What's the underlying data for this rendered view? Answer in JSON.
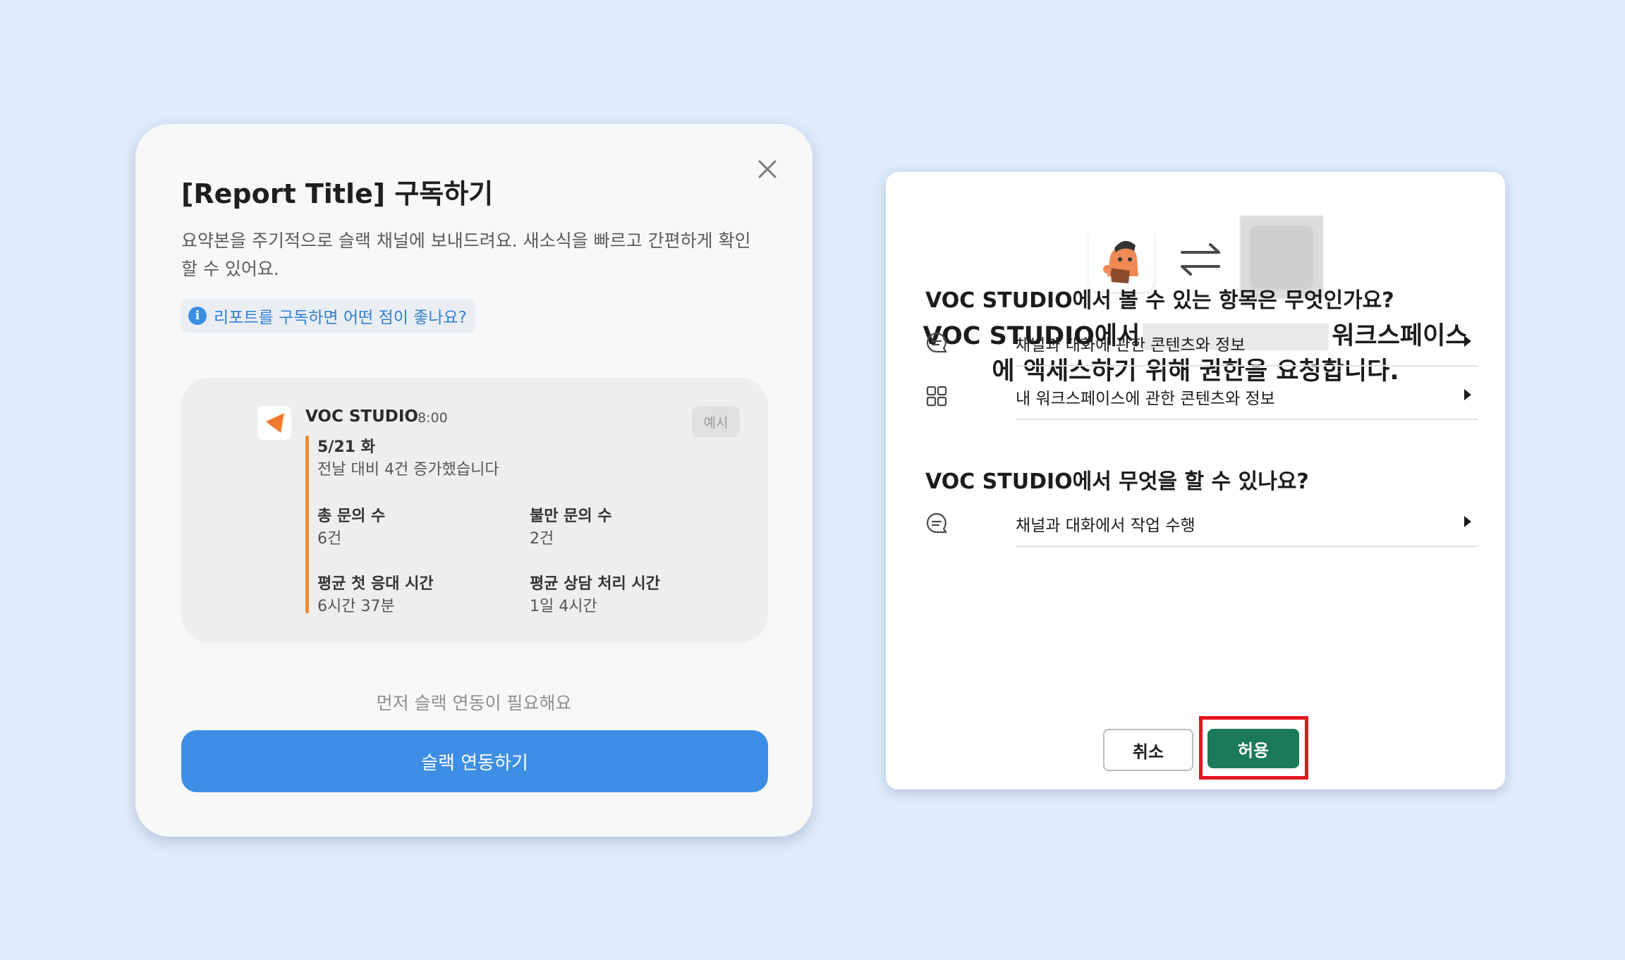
{
  "subscribe_modal": {
    "title": "[Report Title] 구독하기",
    "description": "요약본을 주기적으로 슬랙 채널에 보내드려요. 새소식을 빠르고 간편하게 확인할 수 있어요.",
    "info_link": "리포트를 구독하면 어떤 점이 좋나요?",
    "info_icon": "i",
    "close_icon": "close-icon",
    "preview": {
      "app_name": "VOC STUDIO",
      "time": "8:00",
      "badge": "예시",
      "date": "5/21 화",
      "subtitle": "전날 대비 4건 증가했습니다",
      "stats": [
        {
          "label": "총 문의 수",
          "value": "6건"
        },
        {
          "label": "불만 문의 수",
          "value": "2건"
        },
        {
          "label": "평균 첫 응대 시간",
          "value": "6시간 37분"
        },
        {
          "label": "평균 상담 처리 시간",
          "value": "1일 4시간"
        }
      ],
      "accent_color": "#f08a33"
    },
    "note": "먼저 슬랙 연동이 필요해요",
    "connect_button": "슬랙 연동하기",
    "button_color": "#3e8ee5"
  },
  "permission_dialog": {
    "swap_icon": "swap-arrows-icon",
    "heading_part1": "VOC STUDIO에서",
    "heading_part2": "워크스페이스",
    "heading_line2": "에 액세스하기 위해 권한을 요청합니다.",
    "section_view_title": "VOC STUDIO에서 볼 수 있는 항목은 무엇인가요?",
    "view_items": [
      {
        "icon": "chat-bubble-icon",
        "label": "채널과 대화에 관한 콘텐츠와 정보"
      },
      {
        "icon": "grid-icon",
        "label": "내 워크스페이스에 관한 콘텐츠와 정보"
      }
    ],
    "section_do_title": "VOC STUDIO에서 무엇을 할 수 있나요?",
    "do_items": [
      {
        "icon": "chat-bubble-icon",
        "label": "채널과 대화에서 작업 수행"
      }
    ],
    "cancel_button": "취소",
    "allow_button": "허용",
    "allow_color": "#1b7a5a",
    "highlight_color": "#e5151f"
  }
}
